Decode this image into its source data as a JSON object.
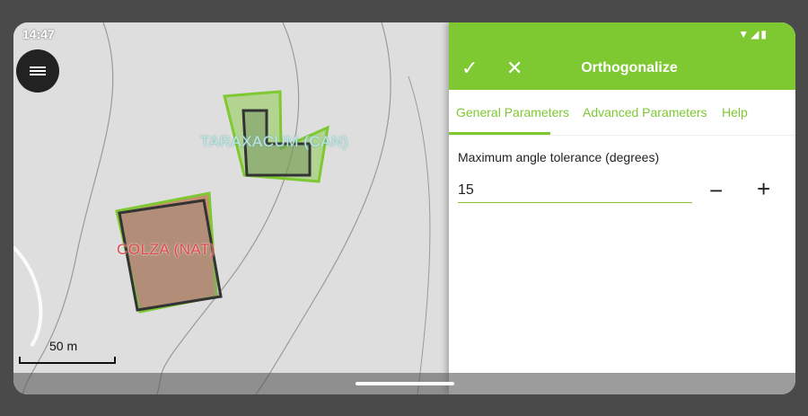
{
  "status_bar": {
    "time": "14:47",
    "icons": "wifi-icon signal-icon battery-icon"
  },
  "map": {
    "layers": [
      {
        "label": "TARAXACUM (CAN)",
        "color": "#bfe7e0"
      },
      {
        "label": "COLZA (NAT)",
        "color": "#e04a4a"
      }
    ],
    "scale_label": "50 m"
  },
  "panel": {
    "title": "Orthogonalize",
    "ok_icon": "check-icon",
    "close_icon": "close-icon",
    "tabs": [
      "General Parameters",
      "Advanced Parameters",
      "Help"
    ],
    "active_tab": "General Parameters",
    "field_label": "Maximum angle tolerance (degrees)",
    "field_value": "15",
    "minus_label": "−",
    "plus_label": "+"
  },
  "colors": {
    "accent": "#7ec832"
  }
}
